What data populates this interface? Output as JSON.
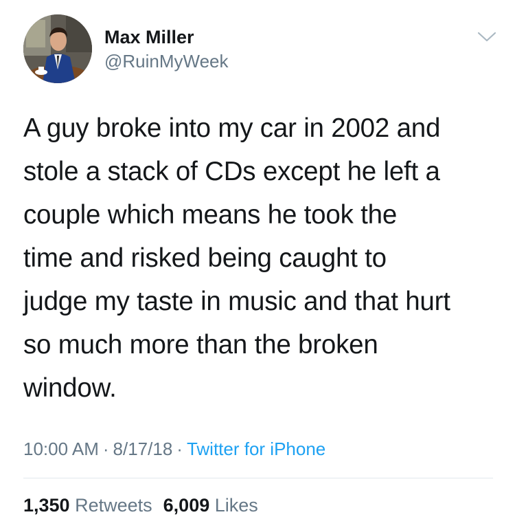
{
  "user": {
    "name": "Max Miller",
    "handle": "@RuinMyWeek",
    "avatar_icon": "profile-photo"
  },
  "tweet": {
    "lines": [
      "A guy broke into my car in 2002 and",
      "stole a stack of CDs except he left a",
      "couple which means he took the",
      "time and risked being caught to",
      "judge my taste in music and that hurt",
      "so much more than the broken",
      "window."
    ]
  },
  "meta": {
    "time": "10:00 AM",
    "separator": "·",
    "date": "8/17/18",
    "source": "Twitter for iPhone"
  },
  "stats": {
    "retweets_count": "1,350",
    "retweets_label": "Retweets",
    "likes_count": "6,009",
    "likes_label": "Likes"
  },
  "colors": {
    "text": "#14171a",
    "secondary": "#657786",
    "link": "#1da1f2",
    "divider": "#e1e8ed"
  },
  "icons": {
    "menu": "chevron-down-icon"
  }
}
